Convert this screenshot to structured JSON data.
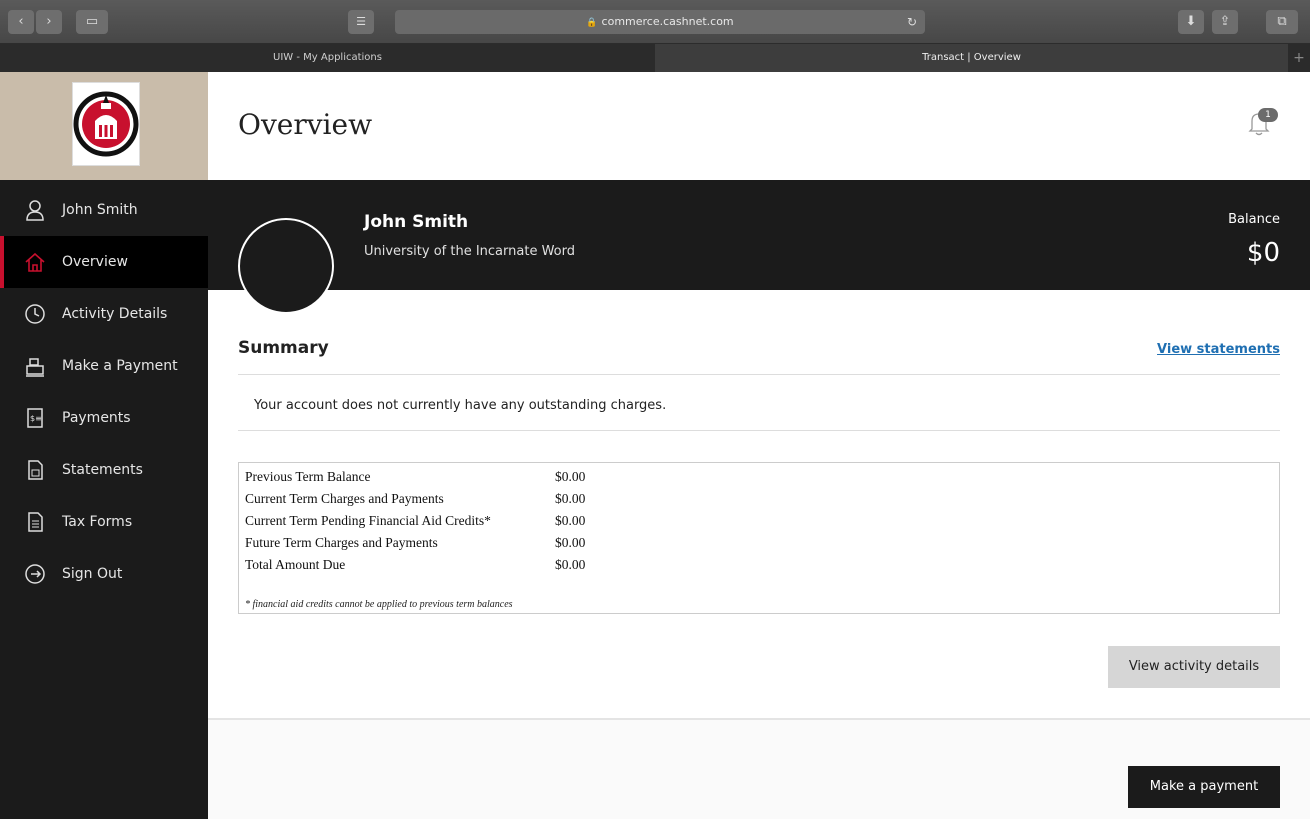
{
  "browser": {
    "url": "commerce.cashnet.com",
    "tabs": [
      {
        "label": "UIW - My Applications",
        "active": false
      },
      {
        "label": "Transact | Overview",
        "active": true
      }
    ]
  },
  "sidebar": {
    "items": [
      {
        "label": "John Smith",
        "icon": "user-icon",
        "active": false
      },
      {
        "label": "Overview",
        "icon": "home-icon",
        "active": true
      },
      {
        "label": "Activity Details",
        "icon": "clock-icon",
        "active": false
      },
      {
        "label": "Make a Payment",
        "icon": "register-icon",
        "active": false
      },
      {
        "label": "Payments",
        "icon": "receipt-icon",
        "active": false
      },
      {
        "label": "Statements",
        "icon": "document-icon",
        "active": false
      },
      {
        "label": "Tax Forms",
        "icon": "forms-icon",
        "active": false
      },
      {
        "label": "Sign Out",
        "icon": "sign-out-icon",
        "active": false
      }
    ]
  },
  "header": {
    "title": "Overview",
    "notification_count": "1"
  },
  "profile": {
    "name": "John Smith",
    "organization": "University of the Incarnate Word",
    "balance_label": "Balance",
    "balance_value": "$0"
  },
  "summary": {
    "title": "Summary",
    "view_statements": "View statements",
    "message": "Your account does not currently have any outstanding charges.",
    "rows": [
      {
        "label": "Previous Term Balance",
        "value": "$0.00"
      },
      {
        "label": "Current Term Charges and Payments",
        "value": "$0.00"
      },
      {
        "label": "Current Term Pending Financial Aid Credits*",
        "value": "$0.00"
      },
      {
        "label": "Future Term Charges and Payments",
        "value": "$0.00"
      },
      {
        "label": "Total Amount Due",
        "value": "$0.00"
      }
    ],
    "footnote": "* financial aid credits cannot be applied to previous term balances"
  },
  "actions": {
    "view_activity": "View activity details",
    "make_payment": "Make a payment"
  },
  "colors": {
    "accent": "#c8102e",
    "sidebar": "#1b1b1b",
    "link": "#1f6fb2"
  }
}
